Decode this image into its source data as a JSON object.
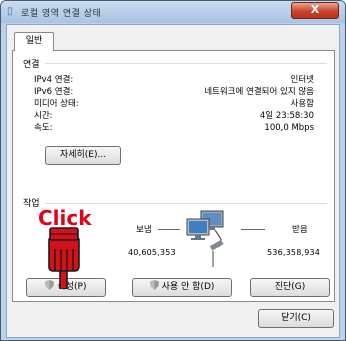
{
  "window": {
    "title": "로컬 영역 연결 상태",
    "close_label": "X"
  },
  "tab": {
    "general": "일반"
  },
  "connection": {
    "title": "연결",
    "rows": [
      {
        "key": "IPv4 연결:",
        "value": "인터넷"
      },
      {
        "key": "IPv6 연결:",
        "value": "네트워크에 연결되어 있지 않음"
      },
      {
        "key": "미디어 상태:",
        "value": "사용함"
      },
      {
        "key": "시간:",
        "value": "4일 23:58:30"
      },
      {
        "key": "속도:",
        "value": "100,0 Mbps"
      }
    ],
    "details_button": "자세히(E)..."
  },
  "activity": {
    "title": "작업",
    "sent_label": "보냄",
    "received_label": "받음",
    "sent_value": "40,605,353",
    "received_value": "536,358,934"
  },
  "buttons": {
    "properties": "속성(P)",
    "disable": "사용 안 함(D)",
    "diagnose": "진단(G)",
    "close": "닫기(C)"
  },
  "annotation": {
    "click_text": "Click"
  },
  "colors": {
    "click_red": "#e3001b",
    "titlebar": "#bcd2ea",
    "close_button": "#c7432c"
  },
  "icons": {
    "title": "network-icon",
    "network": "network-computers-icon",
    "shield": "uac-shield-icon",
    "pointer": "pointing-hand-icon"
  }
}
